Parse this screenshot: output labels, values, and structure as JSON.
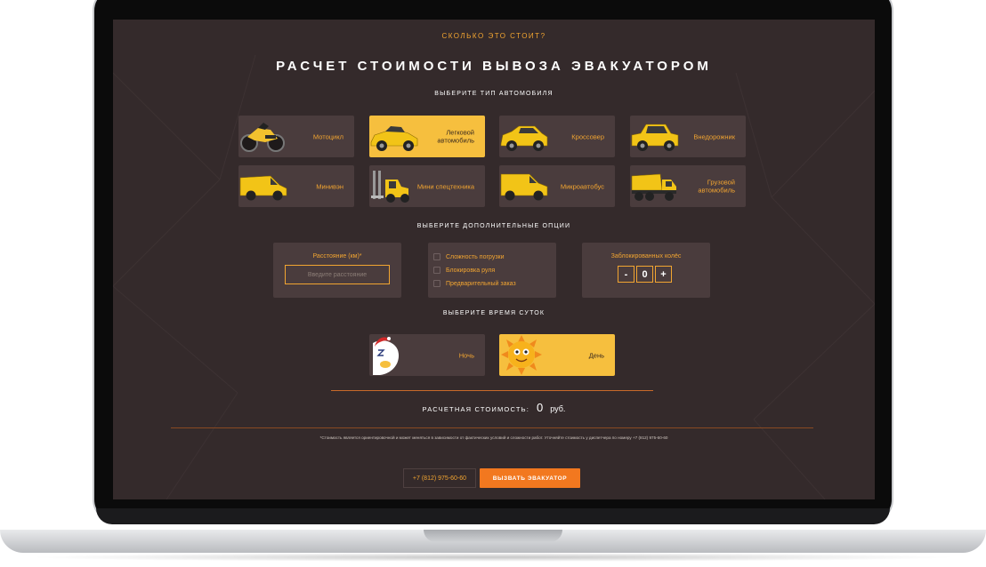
{
  "header": {
    "eyebrow": "СКОЛЬКО ЭТО СТОИТ?",
    "title": "РАСЧЕТ СТОИМОСТИ ВЫВОЗА ЭВАКУАТОРОМ"
  },
  "vehicle_section": {
    "label": "ВЫБЕРИТЕ ТИП АВТОМОБИЛЯ",
    "selected": "Легковой автомобиль",
    "items": [
      {
        "label": "Мотоцикл",
        "icon": "motorcycle-icon"
      },
      {
        "label": "Легковой автомобиль",
        "icon": "car-icon"
      },
      {
        "label": "Кроссовер",
        "icon": "crossover-icon"
      },
      {
        "label": "Внедорожник",
        "icon": "suv-icon"
      },
      {
        "label": "Минивэн",
        "icon": "minivan-icon"
      },
      {
        "label": "Мини спецтехника",
        "icon": "forklift-icon"
      },
      {
        "label": "Микроавтобус",
        "icon": "microbus-icon"
      },
      {
        "label": "Грузовой автомобиль",
        "icon": "truck-icon"
      }
    ]
  },
  "options_section": {
    "label": "ВЫБЕРИТЕ ДОПОЛНИТЕЛЬНЫЕ ОПЦИИ",
    "distance": {
      "title": "Расстояние (км)*",
      "placeholder": "Введите расстояние",
      "value": ""
    },
    "checkboxes": [
      {
        "label": "Сложность погрузки",
        "checked": false
      },
      {
        "label": "Блокировка руля",
        "checked": false
      },
      {
        "label": "Предварительный заказ",
        "checked": false
      }
    ],
    "wheels": {
      "title": "Заблокированных колёс",
      "minus": "-",
      "value": "0",
      "plus": "+"
    }
  },
  "time_section": {
    "label": "ВЫБЕРИТЕ ВРЕМЯ СУТОК",
    "selected": "День",
    "items": [
      {
        "label": "Ночь",
        "icon": "night-moon-icon"
      },
      {
        "label": "День",
        "icon": "sun-icon"
      }
    ]
  },
  "total": {
    "label": "РАСЧЕТНАЯ СТОИМОСТЬ:",
    "value": "0",
    "unit": "руб."
  },
  "note": "*Стоимость является ориентировочной и может меняться в зависимости от фактических условий и сложности работ. Уточняйте стоимость у диспетчера по номеру +7 (812) 975-60-60",
  "footer": {
    "phone": "+7 (812) 975-60-60",
    "call_button": "ВЫЗВАТЬ ЭВАКУАТОР"
  },
  "colors": {
    "accent": "#f2a531",
    "selected": "#f6bf3e",
    "card": "#4a3c3d",
    "background": "#342a2b",
    "button": "#f2781f"
  }
}
